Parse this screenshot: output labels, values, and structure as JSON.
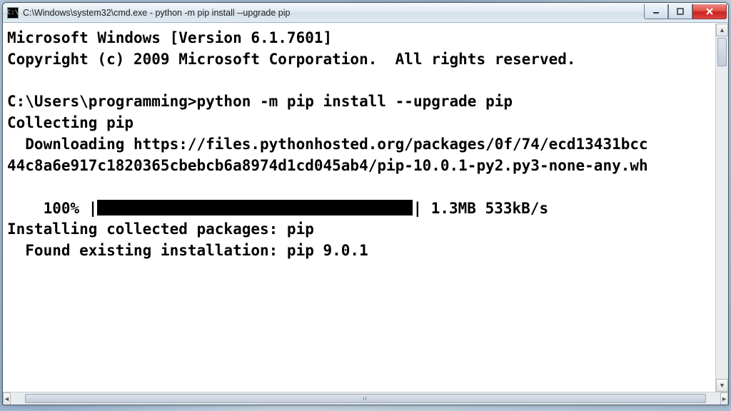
{
  "window": {
    "title": "C:\\Windows\\system32\\cmd.exe - python  -m pip install --upgrade pip",
    "icon_label": "C:\\"
  },
  "console": {
    "line_header1": "Microsoft Windows [Version 6.1.7601]",
    "line_header2": "Copyright (c) 2009 Microsoft Corporation.  All rights reserved.",
    "blank": "",
    "prompt_line": "C:\\Users\\programming>python -m pip install --upgrade pip",
    "collecting": "Collecting pip",
    "downloading1": "  Downloading https://files.pythonhosted.org/packages/0f/74/ecd13431bcc",
    "downloading2": "44c8a6e917c1820365cbebcb6a8974d1cd045ab4/pip-10.0.1-py2.py3-none-any.wh",
    "progress_prefix": "    100% |",
    "progress_suffix": "| 1.3MB 533kB/s",
    "installing": "Installing collected packages: pip",
    "found": "  Found existing installation: pip 9.0.1"
  }
}
